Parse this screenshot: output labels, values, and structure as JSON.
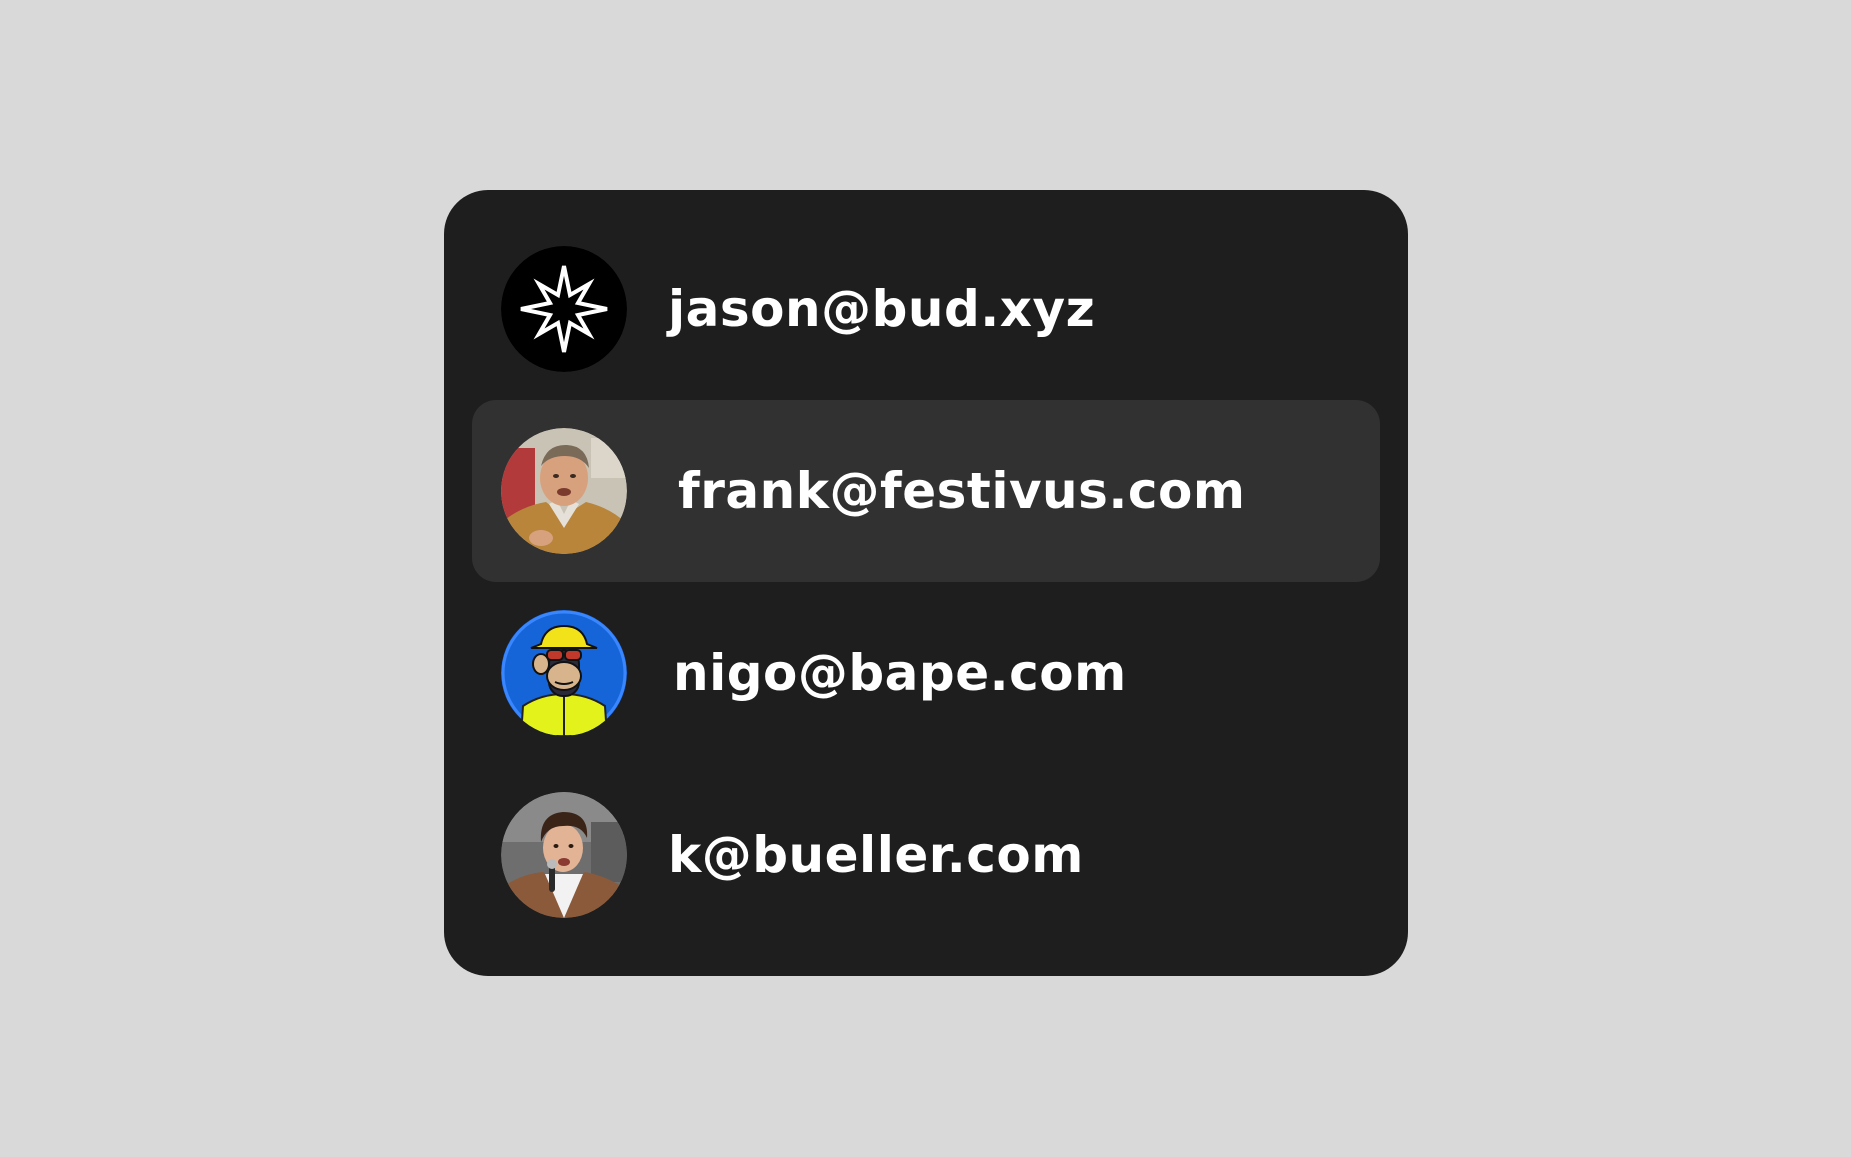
{
  "accounts": [
    {
      "email": "jason@bud.xyz",
      "avatar": "star-logo-icon",
      "selected": false
    },
    {
      "email": "frank@festivus.com",
      "avatar": "photo-older-man-avatar",
      "selected": true
    },
    {
      "email": "nigo@bape.com",
      "avatar": "cartoon-ape-avatar",
      "selected": false
    },
    {
      "email": "k@bueller.com",
      "avatar": "photo-young-man-avatar",
      "selected": false
    }
  ],
  "colors": {
    "background": "#d9d9d9",
    "panel": "#1e1e1e",
    "selected_row": "#313131",
    "text": "#ffffff",
    "ape_bg": "#1565d8",
    "ape_hat": "#f2e21a"
  }
}
